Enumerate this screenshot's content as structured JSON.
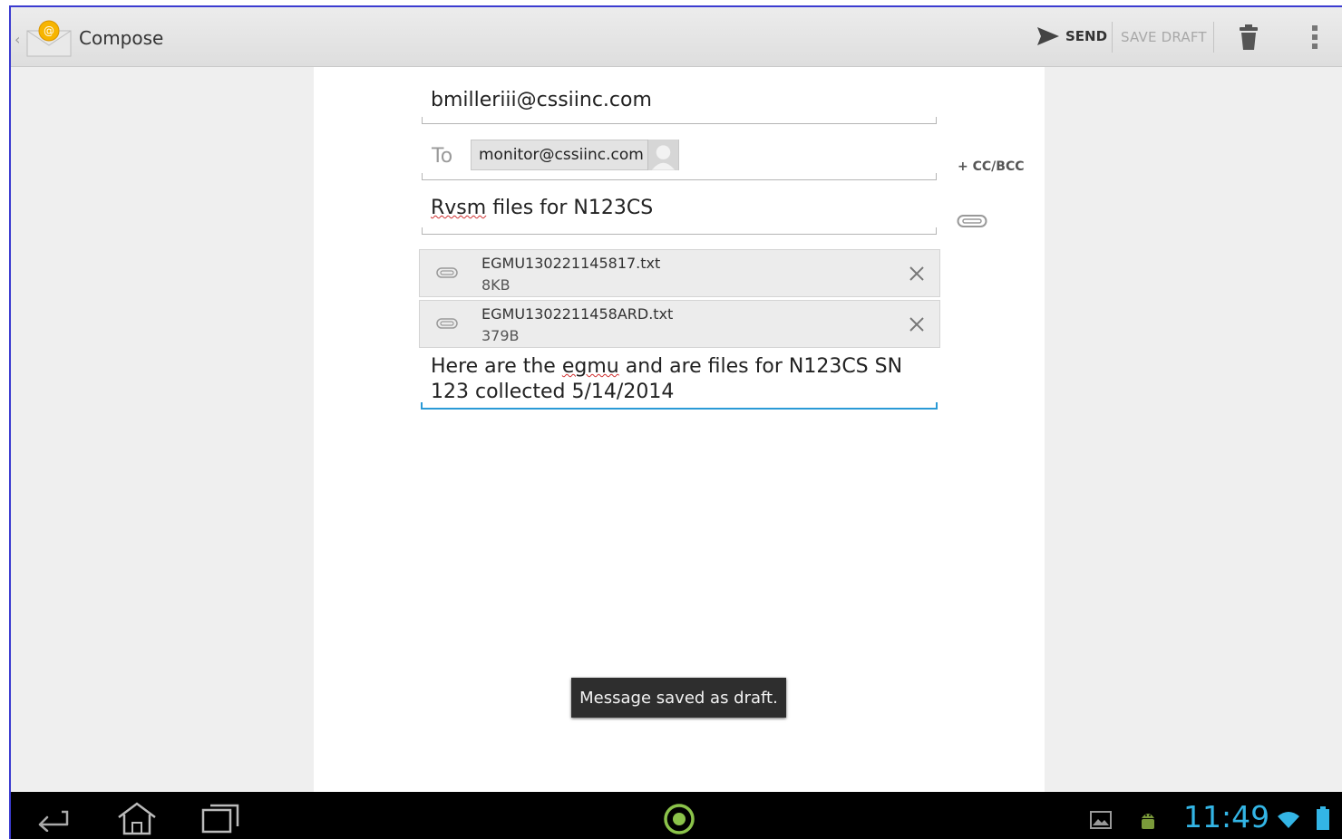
{
  "actionbar": {
    "title": "Compose",
    "send_label": "SEND",
    "save_draft_label": "SAVE DRAFT"
  },
  "compose": {
    "from": "bmilleriii@cssiinc.com",
    "to_label": "To",
    "to_recipient": "monitor@cssiinc.com",
    "cc_bcc_label": "+ CC/BCC",
    "subject_misspelled": "Rvsm",
    "subject_rest": " files for N123CS",
    "body_part1": "Here are the ",
    "body_misspelled": "egmu",
    "body_part2": " and are files for N123CS SN 123 collected 5/14/2014"
  },
  "attachments": [
    {
      "name": "EGMU130221145817.txt",
      "size": "8KB"
    },
    {
      "name": "EGMU1302211458ARD.txt",
      "size": "379B"
    }
  ],
  "toast": {
    "message": "Message saved as draft."
  },
  "statusbar": {
    "time": "11:49"
  },
  "colors": {
    "accent": "#33b5e5",
    "focus_line": "#2a9ad6",
    "center_button": "#8bc34a"
  }
}
